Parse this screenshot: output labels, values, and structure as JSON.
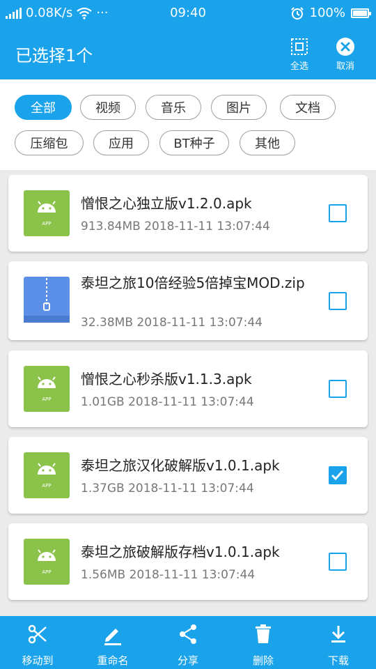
{
  "status_bar": {
    "net_speed": "0.08K/s",
    "more": "···",
    "time": "09:40",
    "battery": "100%",
    "icons": [
      "signal-icon",
      "wifi-icon",
      "alarm-icon",
      "battery-icon"
    ]
  },
  "header": {
    "title": "已选择1个",
    "select_all_label": "全选",
    "cancel_label": "取消"
  },
  "filters": [
    "全部",
    "视频",
    "音乐",
    "图片",
    "文档",
    "压缩包",
    "应用",
    "BT种子",
    "其他"
  ],
  "active_filter": "全部",
  "files": [
    {
      "name": "憎恨之心独立版v1.2.0.apk",
      "size": "913.84MB",
      "date": "2018-11-11 13:07:44",
      "type": "apk",
      "checked": false
    },
    {
      "name": "泰坦之旅10倍经验5倍掉宝MOD.zip",
      "size": "32.38MB",
      "date": "2018-11-11 13:07:44",
      "type": "zip",
      "checked": false
    },
    {
      "name": "憎恨之心秒杀版v1.1.3.apk",
      "size": "1.01GB",
      "date": "2018-11-11 13:07:44",
      "type": "apk",
      "checked": false
    },
    {
      "name": "泰坦之旅汉化破解版v1.0.1.apk",
      "size": "1.37GB",
      "date": "2018-11-11 13:07:44",
      "type": "apk",
      "checked": true
    },
    {
      "name": "泰坦之旅破解版存档v1.0.1.apk",
      "size": "1.56MB",
      "date": "2018-11-11 13:07:44",
      "type": "apk",
      "checked": false
    }
  ],
  "bottom_bar": {
    "move_label": "移动到",
    "rename_label": "重命名",
    "share_label": "分享",
    "delete_label": "删除",
    "download_label": "下载"
  },
  "apk_icon_text": "APP",
  "colors": {
    "accent": "#1aa3ea",
    "apk_icon": "#8bc34a",
    "zip_icon": "#5b8fe8"
  }
}
